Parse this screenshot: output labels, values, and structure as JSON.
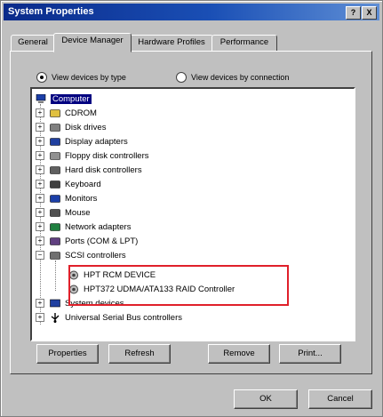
{
  "window": {
    "title": "System Properties",
    "help_button": "?",
    "close_button": "X"
  },
  "tabs": [
    "General",
    "Device Manager",
    "Hardware Profiles",
    "Performance"
  ],
  "view_options": {
    "by_type": "View devices by type",
    "by_connection": "View devices by connection",
    "selected": "by_type"
  },
  "tree": {
    "root": "Computer",
    "items": [
      {
        "label": "CDROM",
        "icon": "cdrom-icon"
      },
      {
        "label": "Disk drives",
        "icon": "disk-drive-icon"
      },
      {
        "label": "Display adapters",
        "icon": "display-adapter-icon"
      },
      {
        "label": "Floppy disk controllers",
        "icon": "floppy-controller-icon"
      },
      {
        "label": "Hard disk controllers",
        "icon": "hard-disk-controller-icon"
      },
      {
        "label": "Keyboard",
        "icon": "keyboard-icon"
      },
      {
        "label": "Monitors",
        "icon": "monitor-icon"
      },
      {
        "label": "Mouse",
        "icon": "mouse-icon"
      },
      {
        "label": "Network adapters",
        "icon": "network-adapter-icon"
      },
      {
        "label": "Ports (COM & LPT)",
        "icon": "port-icon"
      },
      {
        "label": "SCSI controllers",
        "icon": "scsi-controller-icon"
      }
    ],
    "scsi_children": [
      "HPT RCM DEVICE",
      "HPT372 UDMA/ATA133 RAID Controller"
    ],
    "after_items": [
      {
        "label": "System devices",
        "icon": "system-devices-icon"
      },
      {
        "label": "Universal Serial Bus controllers",
        "icon": "usb-icon"
      }
    ]
  },
  "buttons": {
    "properties": "Properties",
    "refresh": "Refresh",
    "remove": "Remove",
    "print": "Print..."
  },
  "dialog_buttons": {
    "ok": "OK",
    "cancel": "Cancel"
  },
  "colors": {
    "title_start": "#0a2a8a",
    "selection": "#000080",
    "highlight": "#e0202a"
  }
}
